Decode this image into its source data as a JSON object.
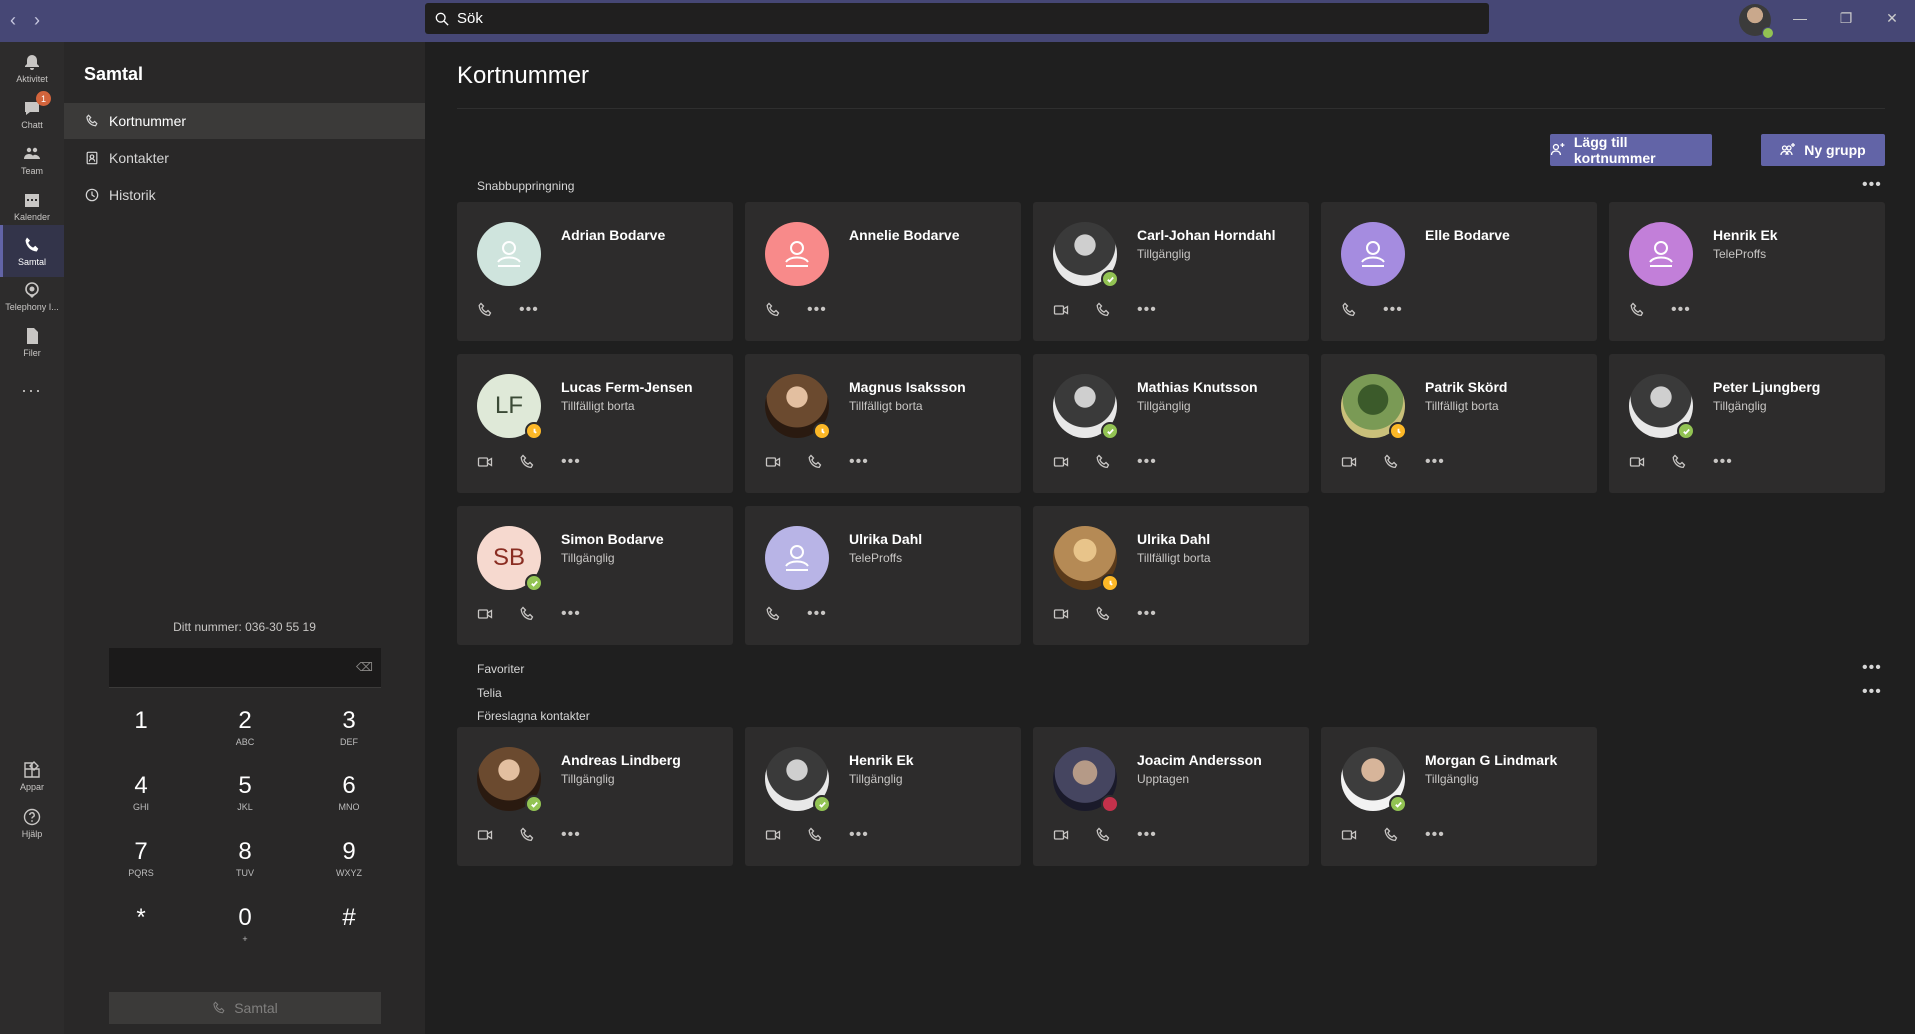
{
  "search": {
    "placeholder": "Sök"
  },
  "rail": [
    {
      "key": "activity",
      "label": "Aktivitet",
      "icon": "bell-icon"
    },
    {
      "key": "chat",
      "label": "Chatt",
      "icon": "chat-icon",
      "badge": "1"
    },
    {
      "key": "teams",
      "label": "Team",
      "icon": "teams-icon"
    },
    {
      "key": "calendar",
      "label": "Kalender",
      "icon": "calendar-icon"
    },
    {
      "key": "calls",
      "label": "Samtal",
      "icon": "phone-icon",
      "active": true
    },
    {
      "key": "telephony",
      "label": "Telephony I...",
      "icon": "telephony-icon"
    },
    {
      "key": "files",
      "label": "Filer",
      "icon": "files-icon"
    },
    {
      "key": "more",
      "label": "...",
      "icon": "more-icon"
    },
    {
      "key": "apps",
      "label": "Appar",
      "icon": "apps-icon"
    },
    {
      "key": "help",
      "label": "Hjälp",
      "icon": "help-icon"
    }
  ],
  "side": {
    "title": "Samtal",
    "items": [
      {
        "label": "Kortnummer",
        "icon": "phone-icon",
        "active": true
      },
      {
        "label": "Kontakter",
        "icon": "contacts-icon"
      },
      {
        "label": "Historik",
        "icon": "history-icon"
      }
    ],
    "my_number": "Ditt nummer: 036-30 55 19",
    "keys": [
      {
        "n": "1",
        "l": ""
      },
      {
        "n": "2",
        "l": "ABC"
      },
      {
        "n": "3",
        "l": "DEF"
      },
      {
        "n": "4",
        "l": "GHI"
      },
      {
        "n": "5",
        "l": "JKL"
      },
      {
        "n": "6",
        "l": "MNO"
      },
      {
        "n": "7",
        "l": "PQRS"
      },
      {
        "n": "8",
        "l": "TUV"
      },
      {
        "n": "9",
        "l": "WXYZ"
      },
      {
        "n": "*",
        "l": ""
      },
      {
        "n": "0",
        "l": "+"
      },
      {
        "n": "#",
        "l": ""
      }
    ],
    "call_label": "Samtal"
  },
  "main": {
    "title": "Kortnummer",
    "add_speed_dial": "Lägg till kortnummer",
    "new_group": "Ny grupp",
    "speed_dial_label": "Snabbuppringning",
    "favorites_label": "Favoriter",
    "telia_label": "Telia",
    "suggested_label": "Föreslagna kontakter",
    "more": "•••"
  },
  "speed_dial": [
    {
      "name": "Adrian Bodarve",
      "status": "",
      "avatar": "person",
      "color": "#cfe4dd",
      "video": false
    },
    {
      "name": "Annelie Bodarve",
      "status": "",
      "avatar": "person",
      "color": "#f88a8a",
      "video": false
    },
    {
      "name": "Carl-Johan Horndahl",
      "status": "Tillgänglig",
      "avatar": "photo",
      "photo": "g1",
      "presence": "available",
      "video": true
    },
    {
      "name": "Elle Bodarve",
      "status": "",
      "avatar": "person",
      "color": "#a58ce0",
      "video": false
    },
    {
      "name": "Henrik Ek",
      "status": "TeleProffs",
      "avatar": "person",
      "color": "#c27fd9",
      "video": false
    },
    {
      "name": "Lucas Ferm-Jensen",
      "status": "Tillfälligt borta",
      "avatar": "initials",
      "initials": "LF",
      "color": "#dfe9d8",
      "ink": "#3b4a36",
      "presence": "away",
      "video": true
    },
    {
      "name": "Magnus Isaksson",
      "status": "Tillfälligt borta",
      "avatar": "photo",
      "photo": "g2",
      "presence": "away",
      "video": true
    },
    {
      "name": "Mathias Knutsson",
      "status": "Tillgänglig",
      "avatar": "photo",
      "photo": "g1",
      "presence": "available",
      "video": true
    },
    {
      "name": "Patrik Skörd",
      "status": "Tillfälligt borta",
      "avatar": "photo",
      "photo": "g3",
      "presence": "away",
      "video": true
    },
    {
      "name": "Peter Ljungberg",
      "status": "Tillgänglig",
      "avatar": "photo",
      "photo": "g1",
      "presence": "available",
      "video": true
    },
    {
      "name": "Simon Bodarve",
      "status": "Tillgänglig",
      "avatar": "initials",
      "initials": "SB",
      "color": "#f6d9cf",
      "ink": "#8a2d22",
      "presence": "available",
      "video": true
    },
    {
      "name": "Ulrika Dahl",
      "status": "TeleProffs",
      "avatar": "person",
      "color": "#b8b4e6",
      "video": false
    },
    {
      "name": "Ulrika Dahl",
      "status": "Tillfälligt borta",
      "avatar": "photo",
      "photo": "g4",
      "presence": "away",
      "video": true
    }
  ],
  "suggested": [
    {
      "name": "Andreas Lindberg",
      "status": "Tillgänglig",
      "avatar": "photo",
      "photo": "g2",
      "presence": "available",
      "video": true
    },
    {
      "name": "Henrik Ek",
      "status": "Tillgänglig",
      "avatar": "photo",
      "photo": "g1",
      "presence": "available",
      "video": true
    },
    {
      "name": "Joacim Andersson",
      "status": "Upptagen",
      "avatar": "photo",
      "photo": "g6",
      "presence": "busy",
      "video": true
    },
    {
      "name": "Morgan G Lindmark",
      "status": "Tillgänglig",
      "avatar": "photo",
      "photo": "g5",
      "presence": "available",
      "video": true
    }
  ]
}
